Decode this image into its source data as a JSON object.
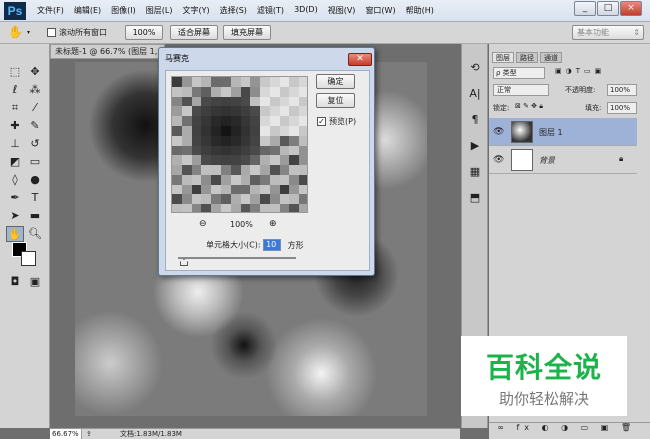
{
  "app": {
    "logo": "Ps",
    "menu": [
      "文件(F)",
      "编辑(E)",
      "图像(I)",
      "图层(L)",
      "文字(Y)",
      "选择(S)",
      "滤镜(T)",
      "3D(D)",
      "视图(V)",
      "窗口(W)",
      "帮助(H)"
    ],
    "win_min": "_",
    "win_max": "□",
    "win_close": "×"
  },
  "options": {
    "scroll_all_label": "滚动所有窗口",
    "zoom100": "100%",
    "fit_screen": "适合屏幕",
    "fill_screen": "填充屏幕",
    "workspace": "基本功能"
  },
  "document": {
    "tab_title": "未标题-1 @ 66.7% (图层 1, RGB/8)",
    "zoom": "66.67%",
    "doc_info": "文档:1.83M/1.83M"
  },
  "dialog": {
    "title": "马赛克",
    "close": "✕",
    "ok": "确定",
    "reset": "复位",
    "preview_label": "预览(P)",
    "preview_checked": true,
    "zoom_out": "⊖",
    "zoom_level": "100%",
    "zoom_in": "⊕",
    "cell_size_label": "单元格大小(C):",
    "cell_size_value": "10",
    "cell_unit": "方形"
  },
  "layers": {
    "tabs": [
      "图层",
      "路径",
      "通道"
    ],
    "filter_kind": "ρ 类型",
    "blend_mode": "正常",
    "opacity_label": "不透明度:",
    "opacity": "100%",
    "lock_label": "锁定:",
    "fill_label": "填充:",
    "fill": "100%",
    "items": [
      {
        "name": "图层 1",
        "selected": true
      },
      {
        "name": "背景",
        "locked": true
      }
    ]
  },
  "watermark": {
    "line1": "百科全说",
    "line2": "助你轻松解决"
  }
}
